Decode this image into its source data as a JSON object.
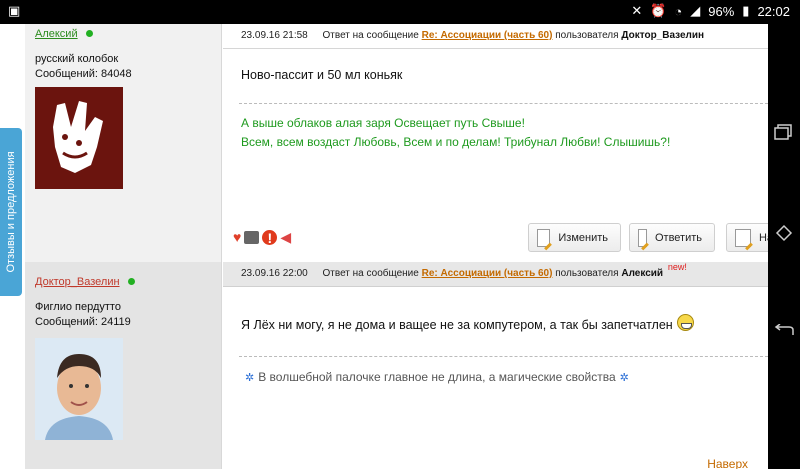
{
  "status_bar": {
    "battery_level": "96%",
    "time": "22:02"
  },
  "feedback_tab": {
    "label": "Отзывы и предложения"
  },
  "posts": [
    {
      "username": "Алексий",
      "user_title": "русский колобок",
      "post_count": "Сообщений: 84048",
      "date": "23.09.16 21:58",
      "reply_prefix": "Ответ на сообщение",
      "reply_topic": "Re: Ассоциации (часть 60)",
      "reply_user_prefix": "пользователя",
      "reply_user": "Доктор_Вазелин",
      "text": "Ново-пассит и 50 мл коньяк",
      "signature_line1": "А выше облаков алая заря Освещает путь Свыше!",
      "signature_line2": "Всем, всем воздаст Любовь, Всем и по делам! Трибунал Любви! Слышишь?!"
    },
    {
      "username": "Доктор_Вазелин",
      "user_title": "Фиглио пердутто",
      "post_count": "Сообщений: 24119",
      "date": "23.09.16 22:00",
      "reply_prefix": "Ответ на сообщение",
      "reply_topic": "Re: Ассоциации (часть 60)",
      "reply_user_prefix": "пользователя",
      "reply_user": "Алексий",
      "new_label": "new!",
      "text": "Я Лёх ни могу, я не дома и ващее не за компутером, а так бы запетчатлен",
      "signature": "В волшебной палочке главное не длина, а магические свойства"
    }
  ],
  "buttons": {
    "edit": "Изменить",
    "reply": "Ответить",
    "more": "На"
  },
  "to_top": "Наверх"
}
